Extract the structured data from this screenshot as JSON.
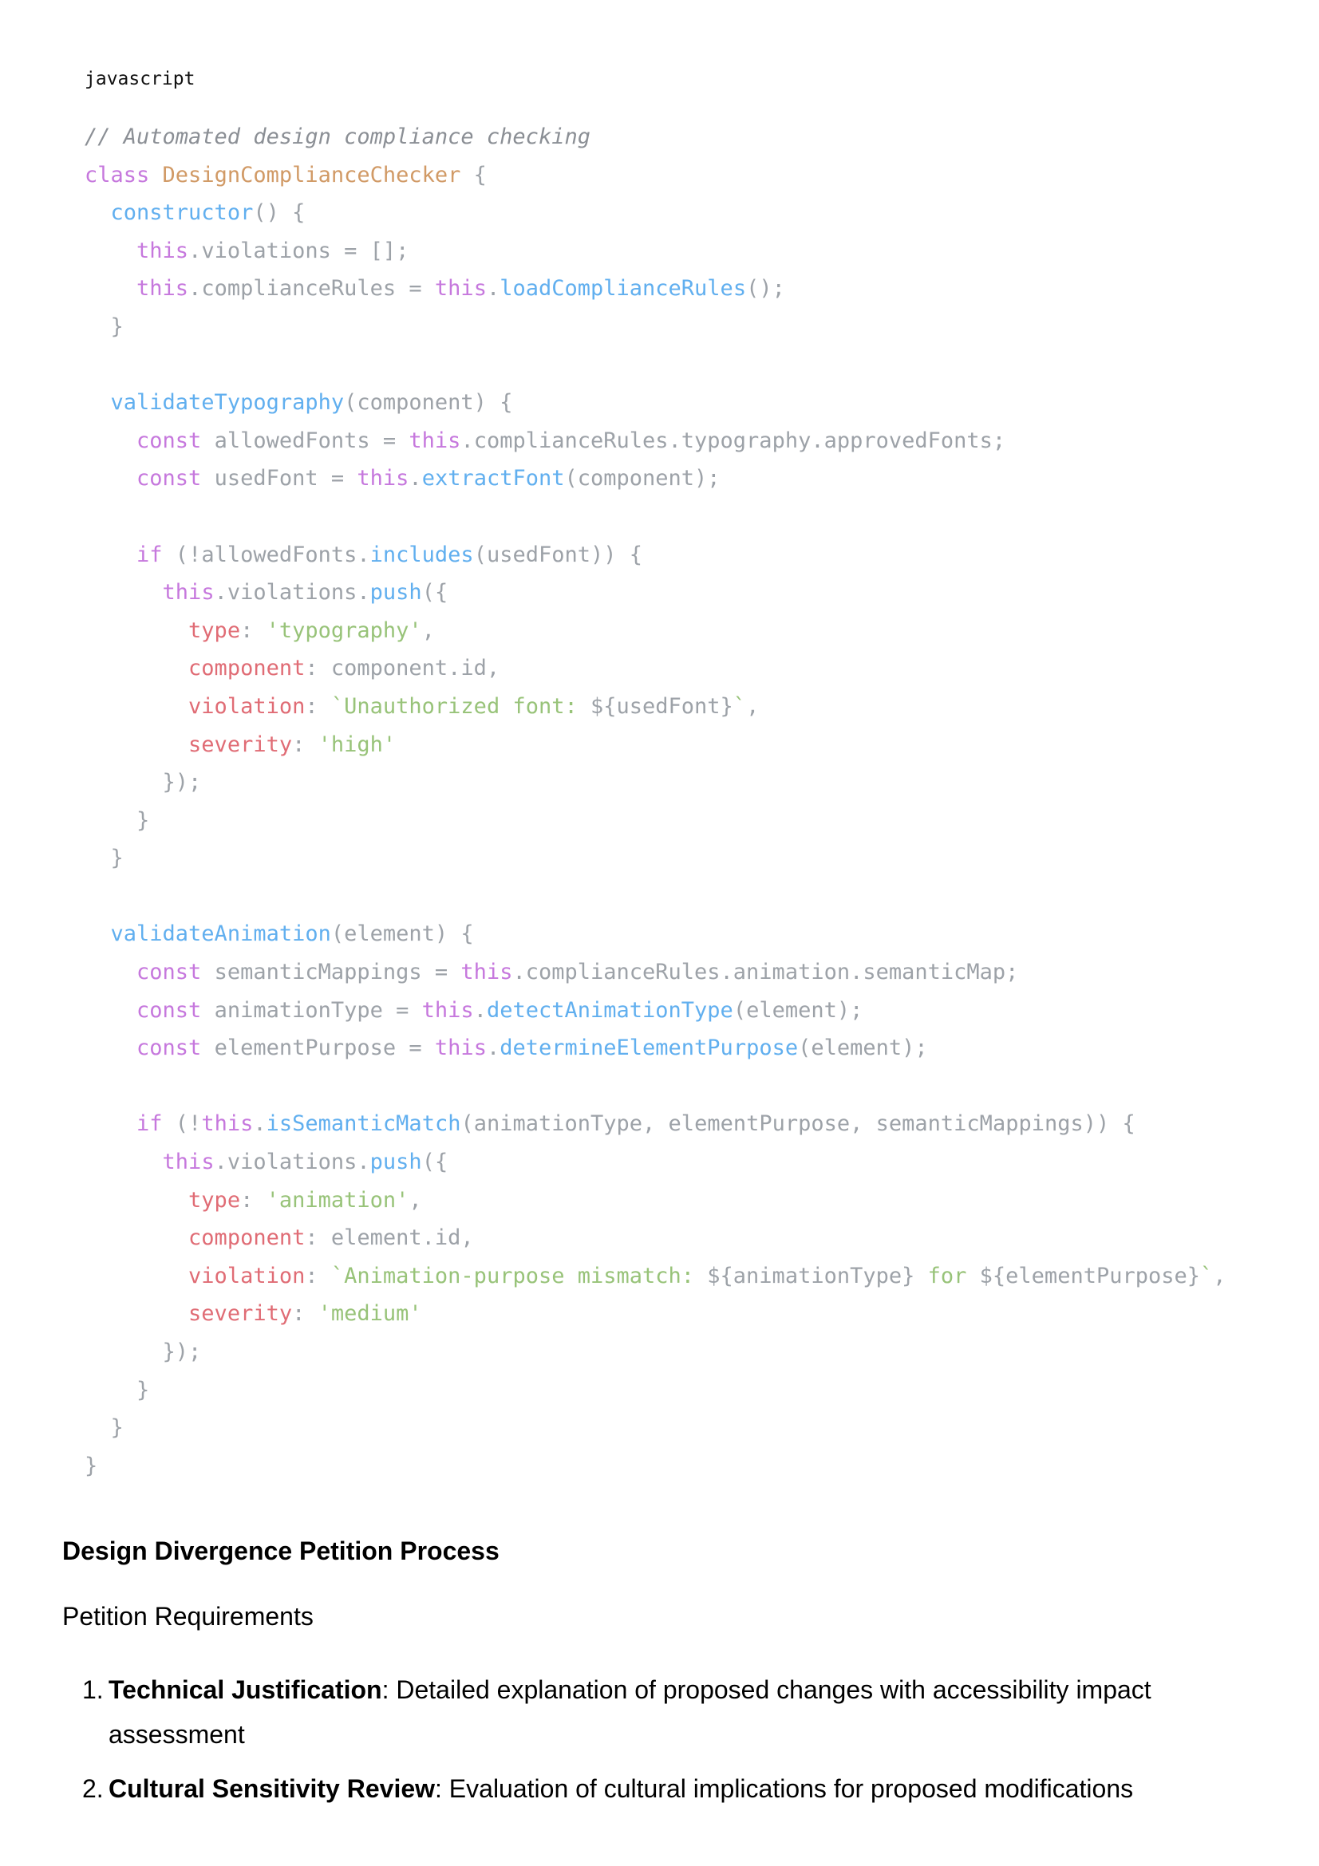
{
  "code_block": {
    "language": "javascript",
    "lines": [
      [
        {
          "t": "// Automated design compliance checking",
          "c": "comment"
        }
      ],
      [
        {
          "t": "class ",
          "c": "keyword"
        },
        {
          "t": "DesignComplianceChecker",
          "c": "class"
        },
        {
          "t": " {",
          "c": "plain"
        }
      ],
      [
        {
          "t": "  ",
          "c": "plain"
        },
        {
          "t": "constructor",
          "c": "func"
        },
        {
          "t": "() {",
          "c": "plain"
        }
      ],
      [
        {
          "t": "    ",
          "c": "plain"
        },
        {
          "t": "this",
          "c": "keyword"
        },
        {
          "t": ".violations = [];",
          "c": "plain"
        }
      ],
      [
        {
          "t": "    ",
          "c": "plain"
        },
        {
          "t": "this",
          "c": "keyword"
        },
        {
          "t": ".complianceRules = ",
          "c": "plain"
        },
        {
          "t": "this",
          "c": "keyword"
        },
        {
          "t": ".",
          "c": "plain"
        },
        {
          "t": "loadComplianceRules",
          "c": "func"
        },
        {
          "t": "();",
          "c": "plain"
        }
      ],
      [
        {
          "t": "  }",
          "c": "plain"
        }
      ],
      [
        {
          "t": "",
          "c": "plain"
        }
      ],
      [
        {
          "t": "  ",
          "c": "plain"
        },
        {
          "t": "validateTypography",
          "c": "func"
        },
        {
          "t": "(component) {",
          "c": "plain"
        }
      ],
      [
        {
          "t": "    ",
          "c": "plain"
        },
        {
          "t": "const",
          "c": "keyword"
        },
        {
          "t": " allowedFonts = ",
          "c": "plain"
        },
        {
          "t": "this",
          "c": "keyword"
        },
        {
          "t": ".complianceRules.typography.approvedFonts;",
          "c": "plain"
        }
      ],
      [
        {
          "t": "    ",
          "c": "plain"
        },
        {
          "t": "const",
          "c": "keyword"
        },
        {
          "t": " usedFont = ",
          "c": "plain"
        },
        {
          "t": "this",
          "c": "keyword"
        },
        {
          "t": ".",
          "c": "plain"
        },
        {
          "t": "extractFont",
          "c": "func"
        },
        {
          "t": "(component);",
          "c": "plain"
        }
      ],
      [
        {
          "t": "",
          "c": "plain"
        }
      ],
      [
        {
          "t": "    ",
          "c": "plain"
        },
        {
          "t": "if",
          "c": "keyword"
        },
        {
          "t": " (!allowedFonts.",
          "c": "plain"
        },
        {
          "t": "includes",
          "c": "func"
        },
        {
          "t": "(usedFont)) {",
          "c": "plain"
        }
      ],
      [
        {
          "t": "      ",
          "c": "plain"
        },
        {
          "t": "this",
          "c": "keyword"
        },
        {
          "t": ".violations.",
          "c": "plain"
        },
        {
          "t": "push",
          "c": "func"
        },
        {
          "t": "({",
          "c": "plain"
        }
      ],
      [
        {
          "t": "        ",
          "c": "plain"
        },
        {
          "t": "type",
          "c": "prop"
        },
        {
          "t": ": ",
          "c": "plain"
        },
        {
          "t": "'typography'",
          "c": "string"
        },
        {
          "t": ",",
          "c": "plain"
        }
      ],
      [
        {
          "t": "        ",
          "c": "plain"
        },
        {
          "t": "component",
          "c": "prop"
        },
        {
          "t": ": component.id,",
          "c": "plain"
        }
      ],
      [
        {
          "t": "        ",
          "c": "plain"
        },
        {
          "t": "violation",
          "c": "prop"
        },
        {
          "t": ": ",
          "c": "plain"
        },
        {
          "t": "`Unauthorized font: ",
          "c": "string"
        },
        {
          "t": "${usedFont}",
          "c": "plain"
        },
        {
          "t": "`",
          "c": "string"
        },
        {
          "t": ",",
          "c": "plain"
        }
      ],
      [
        {
          "t": "        ",
          "c": "plain"
        },
        {
          "t": "severity",
          "c": "prop"
        },
        {
          "t": ": ",
          "c": "plain"
        },
        {
          "t": "'high'",
          "c": "string"
        }
      ],
      [
        {
          "t": "      });",
          "c": "plain"
        }
      ],
      [
        {
          "t": "    }",
          "c": "plain"
        }
      ],
      [
        {
          "t": "  }",
          "c": "plain"
        }
      ],
      [
        {
          "t": "",
          "c": "plain"
        }
      ],
      [
        {
          "t": "  ",
          "c": "plain"
        },
        {
          "t": "validateAnimation",
          "c": "func"
        },
        {
          "t": "(element) {",
          "c": "plain"
        }
      ],
      [
        {
          "t": "    ",
          "c": "plain"
        },
        {
          "t": "const",
          "c": "keyword"
        },
        {
          "t": " semanticMappings = ",
          "c": "plain"
        },
        {
          "t": "this",
          "c": "keyword"
        },
        {
          "t": ".complianceRules.animation.semanticMap;",
          "c": "plain"
        }
      ],
      [
        {
          "t": "    ",
          "c": "plain"
        },
        {
          "t": "const",
          "c": "keyword"
        },
        {
          "t": " animationType = ",
          "c": "plain"
        },
        {
          "t": "this",
          "c": "keyword"
        },
        {
          "t": ".",
          "c": "plain"
        },
        {
          "t": "detectAnimationType",
          "c": "func"
        },
        {
          "t": "(element);",
          "c": "plain"
        }
      ],
      [
        {
          "t": "    ",
          "c": "plain"
        },
        {
          "t": "const",
          "c": "keyword"
        },
        {
          "t": " elementPurpose = ",
          "c": "plain"
        },
        {
          "t": "this",
          "c": "keyword"
        },
        {
          "t": ".",
          "c": "plain"
        },
        {
          "t": "determineElementPurpose",
          "c": "func"
        },
        {
          "t": "(element);",
          "c": "plain"
        }
      ],
      [
        {
          "t": "",
          "c": "plain"
        }
      ],
      [
        {
          "t": "    ",
          "c": "plain"
        },
        {
          "t": "if",
          "c": "keyword"
        },
        {
          "t": " (!",
          "c": "plain"
        },
        {
          "t": "this",
          "c": "keyword"
        },
        {
          "t": ".",
          "c": "plain"
        },
        {
          "t": "isSemanticMatch",
          "c": "func"
        },
        {
          "t": "(animationType, elementPurpose, semanticMappings)) {",
          "c": "plain"
        }
      ],
      [
        {
          "t": "      ",
          "c": "plain"
        },
        {
          "t": "this",
          "c": "keyword"
        },
        {
          "t": ".violations.",
          "c": "plain"
        },
        {
          "t": "push",
          "c": "func"
        },
        {
          "t": "({",
          "c": "plain"
        }
      ],
      [
        {
          "t": "        ",
          "c": "plain"
        },
        {
          "t": "type",
          "c": "prop"
        },
        {
          "t": ": ",
          "c": "plain"
        },
        {
          "t": "'animation'",
          "c": "string"
        },
        {
          "t": ",",
          "c": "plain"
        }
      ],
      [
        {
          "t": "        ",
          "c": "plain"
        },
        {
          "t": "component",
          "c": "prop"
        },
        {
          "t": ": element.id,",
          "c": "plain"
        }
      ],
      [
        {
          "t": "        ",
          "c": "plain"
        },
        {
          "t": "violation",
          "c": "prop"
        },
        {
          "t": ": ",
          "c": "plain"
        },
        {
          "t": "`Animation-purpose mismatch: ",
          "c": "string"
        },
        {
          "t": "${animationType}",
          "c": "plain"
        },
        {
          "t": " for ",
          "c": "string"
        },
        {
          "t": "${elementPurpose}",
          "c": "plain"
        },
        {
          "t": "`",
          "c": "string"
        },
        {
          "t": ",",
          "c": "plain"
        }
      ],
      [
        {
          "t": "        ",
          "c": "plain"
        },
        {
          "t": "severity",
          "c": "prop"
        },
        {
          "t": ": ",
          "c": "plain"
        },
        {
          "t": "'medium'",
          "c": "string"
        }
      ],
      [
        {
          "t": "      });",
          "c": "plain"
        }
      ],
      [
        {
          "t": "    }",
          "c": "plain"
        }
      ],
      [
        {
          "t": "  }",
          "c": "plain"
        }
      ],
      [
        {
          "t": "}",
          "c": "plain"
        }
      ]
    ]
  },
  "section": {
    "heading": "Design Divergence Petition Process",
    "subheading": "Petition Requirements",
    "requirements": [
      {
        "number": "1.",
        "term": "Technical Justification",
        "text": ": Detailed explanation of proposed changes with accessibility impact assessment"
      },
      {
        "number": "2.",
        "term": "Cultural Sensitivity Review",
        "text": ": Evaluation of cultural implications for proposed modifications"
      }
    ]
  },
  "syntax_colors": {
    "comment": "#8b8f95",
    "keyword": "#c678dd",
    "class": "#d19a66",
    "func": "#61afef",
    "prop": "#e06c75",
    "string": "#98c379",
    "plain": "#9da2a8"
  }
}
